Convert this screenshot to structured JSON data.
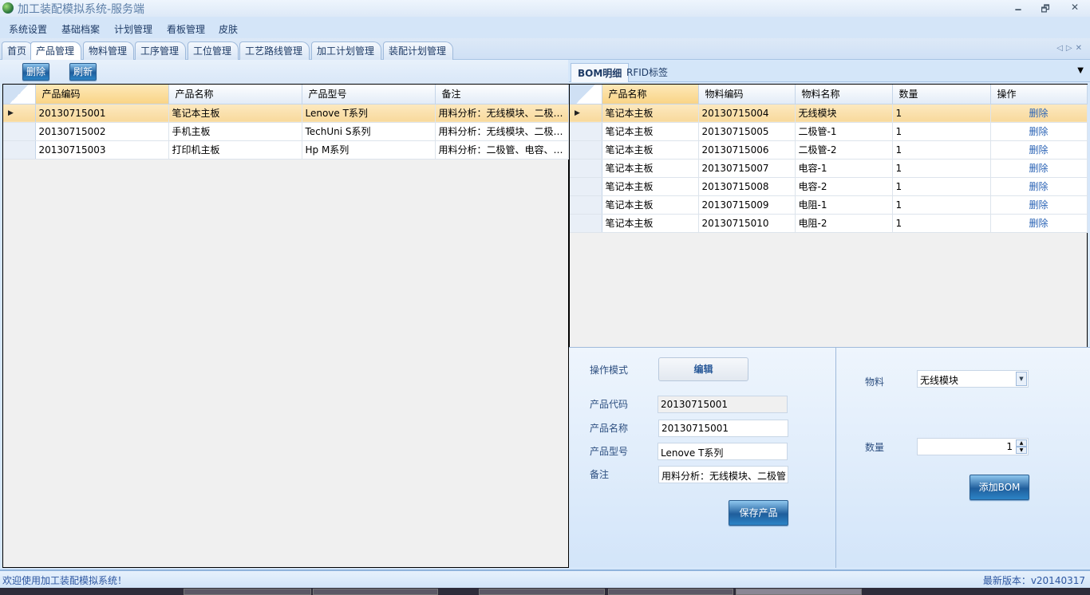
{
  "window": {
    "title": "加工装配模拟系统-服务端",
    "minimize": "🗕",
    "restore": "🗗",
    "close": "✕"
  },
  "menu": [
    "系统设置",
    "基础档案",
    "计划管理",
    "看板管理",
    "皮肤"
  ],
  "tabs": [
    "首页",
    "产品管理",
    "物料管理",
    "工序管理",
    "工位管理",
    "工艺路线管理",
    "加工计划管理",
    "装配计划管理"
  ],
  "tab_nav": "◁▷✕",
  "toolbar": {
    "delete": "删除",
    "refresh": "刷新"
  },
  "product_grid": {
    "columns": [
      "产品编码",
      "产品名称",
      "产品型号",
      "备注"
    ],
    "rows": [
      [
        "20130715001",
        "笔记本主板",
        "Lenove T系列",
        "用料分析：无线模块、二极管、电容、电阻"
      ],
      [
        "20130715002",
        "手机主板",
        "TechUni  S系列",
        "用料分析：无线模块、二极管、电容、电阻"
      ],
      [
        "20130715003",
        "打印机主板",
        "Hp M系列",
        "用料分析：二极管、电容、电阻"
      ]
    ],
    "current_marker": "▶"
  },
  "right_tabs": [
    "BOM明细",
    "RFID标签"
  ],
  "right_tabs_menu": "▼",
  "bom_grid": {
    "columns": [
      "产品名称",
      "物料编码",
      "物料名称",
      "数量",
      "操作"
    ],
    "rows": [
      [
        "笔记本主板",
        "20130715004",
        "无线模块",
        "1",
        "删除"
      ],
      [
        "笔记本主板",
        "20130715005",
        "二极管-1",
        "1",
        "删除"
      ],
      [
        "笔记本主板",
        "20130715006",
        "二极管-2",
        "1",
        "删除"
      ],
      [
        "笔记本主板",
        "20130715007",
        "电容-1",
        "1",
        "删除"
      ],
      [
        "笔记本主板",
        "20130715008",
        "电容-2",
        "1",
        "删除"
      ],
      [
        "笔记本主板",
        "20130715009",
        "电阻-1",
        "1",
        "删除"
      ],
      [
        "笔记本主板",
        "20130715010",
        "电阻-2",
        "1",
        "删除"
      ]
    ]
  },
  "form": {
    "mode_label": "操作模式",
    "mode_value": "编辑",
    "code_label": "产品代码",
    "code_value": "20130715001",
    "name_label": "产品名称",
    "name_value": "20130715001",
    "model_label": "产品型号",
    "model_value": "Lenove T系列",
    "note_label": "备注",
    "note_value": "用料分析：无线模块、二极管",
    "save": "保存产品",
    "material_label": "物料",
    "material_value": "无线模块",
    "qty_label": "数量",
    "qty_value": "1",
    "add_bom": "添加BOM"
  },
  "status": {
    "welcome": "欢迎使用加工装配模拟系统！",
    "version": "最新版本：v20140317"
  }
}
